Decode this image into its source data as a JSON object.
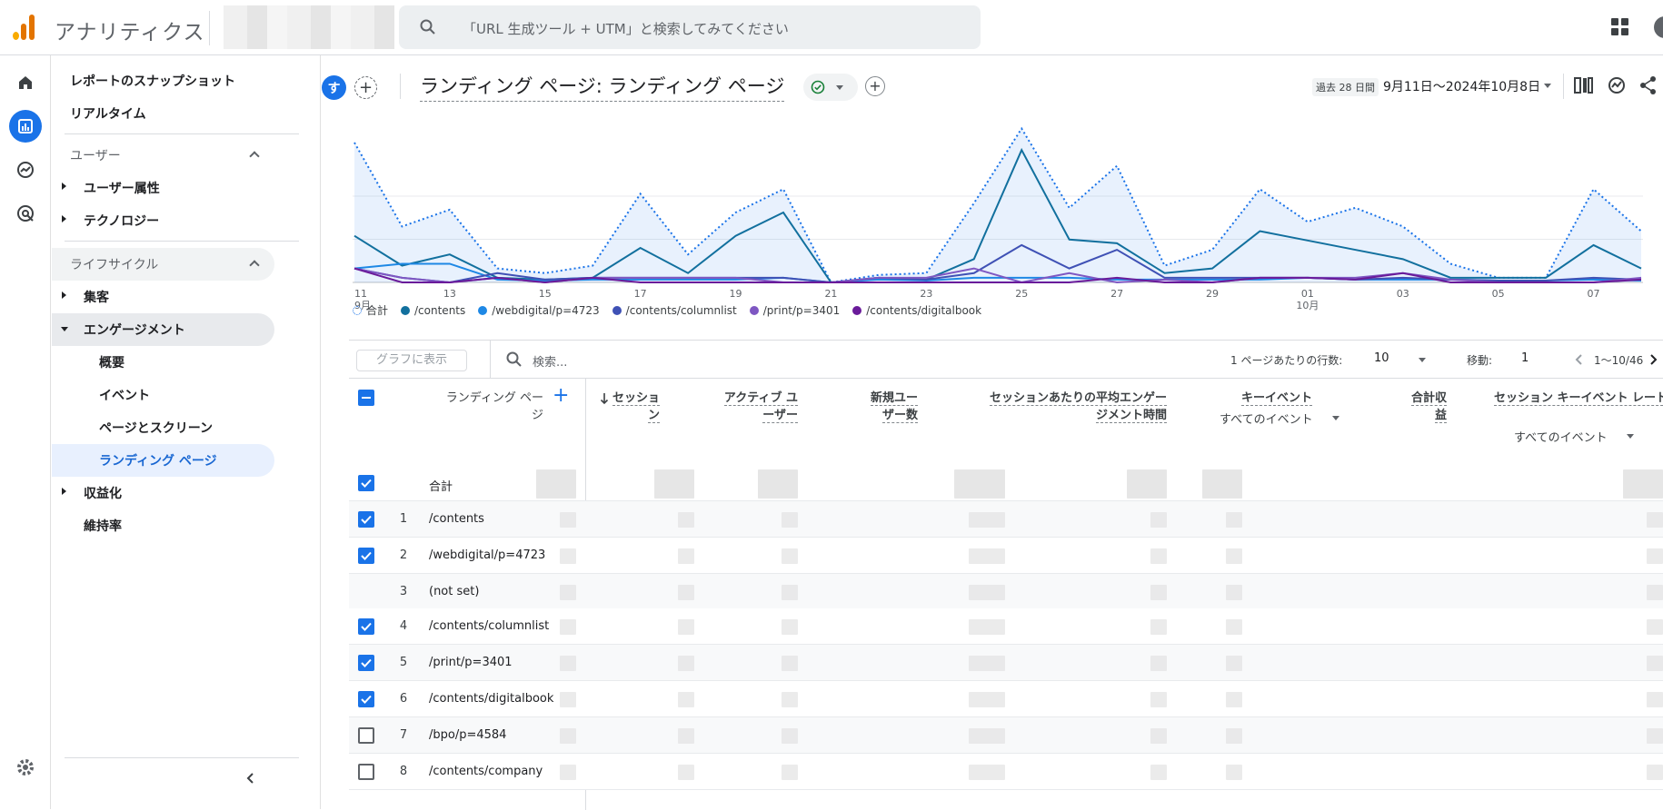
{
  "app": {
    "title": "アナリティクス",
    "search_placeholder": "「URL 生成ツール + UTM」と検索してみてください"
  },
  "nav": {
    "snapshot": "レポートのスナップショット",
    "realtime": "リアルタイム",
    "user_section": "ユーザー",
    "user_attributes": "ユーザー属性",
    "technology": "テクノロジー",
    "lifecycle_section": "ライフサイクル",
    "acquisition": "集客",
    "engagement": "エンゲージメント",
    "overview": "概要",
    "events": "イベント",
    "pages_screens": "ページとスクリーン",
    "landing_page": "ランディング ページ",
    "monetization": "収益化",
    "retention": "維持率"
  },
  "header": {
    "avatar_letter": "す",
    "report_title": "ランディング ページ: ランディング ページ",
    "date_chip": "過去 28 日間",
    "date_range": "9月11日～2024年10月8日"
  },
  "chart_data": {
    "type": "line",
    "x": [
      "11",
      "12",
      "13",
      "14",
      "15",
      "16",
      "17",
      "18",
      "19",
      "20",
      "21",
      "22",
      "23",
      "24",
      "25",
      "26",
      "27",
      "28",
      "29",
      "30",
      "01",
      "02",
      "03",
      "04",
      "05",
      "06",
      "07",
      "08"
    ],
    "x_ticks": [
      "11",
      "13",
      "15",
      "17",
      "19",
      "21",
      "23",
      "25",
      "27",
      "29",
      "01",
      "03",
      "05",
      "07"
    ],
    "x_month_labels": [
      {
        "at": "11",
        "label": "9月"
      },
      {
        "at": "01",
        "label": "10月"
      }
    ],
    "series": [
      {
        "name": "合計",
        "color": "#1a73e8",
        "style": "dotted-area",
        "values": [
          150,
          60,
          78,
          15,
          10,
          18,
          95,
          30,
          75,
          100,
          0,
          8,
          10,
          85,
          165,
          80,
          125,
          18,
          35,
          100,
          65,
          80,
          60,
          20,
          5,
          5,
          100,
          55
        ]
      },
      {
        "name": "/contents",
        "color": "#12709e",
        "values": [
          50,
          18,
          30,
          5,
          3,
          5,
          37,
          10,
          50,
          75,
          0,
          5,
          3,
          25,
          142,
          46,
          42,
          10,
          15,
          55,
          45,
          35,
          25,
          5,
          5,
          5,
          40,
          15
        ]
      },
      {
        "name": "/webdigital/p=4723",
        "color": "#1e88e5",
        "values": [
          15,
          20,
          20,
          3,
          2,
          3,
          3,
          3,
          3,
          5,
          0,
          3,
          2,
          5,
          5,
          5,
          3,
          3,
          3,
          3,
          5,
          3,
          3,
          3,
          2,
          2,
          3,
          2
        ]
      },
      {
        "name": "/contents/columnlist",
        "color": "#3f51b5",
        "values": [
          15,
          5,
          0,
          10,
          3,
          5,
          5,
          5,
          5,
          5,
          0,
          5,
          3,
          10,
          40,
          15,
          35,
          5,
          5,
          5,
          5,
          3,
          5,
          3,
          2,
          2,
          5,
          3
        ]
      },
      {
        "name": "/print/p=3401",
        "color": "#7e57c2",
        "values": [
          15,
          5,
          0,
          5,
          0,
          5,
          5,
          5,
          5,
          0,
          0,
          5,
          5,
          15,
          0,
          10,
          0,
          3,
          0,
          5,
          5,
          5,
          10,
          3,
          0,
          0,
          0,
          5
        ]
      },
      {
        "name": "/contents/digitalbook",
        "color": "#6a1b9a",
        "values": [
          15,
          0,
          0,
          5,
          0,
          5,
          0,
          0,
          0,
          0,
          0,
          0,
          0,
          0,
          0,
          0,
          5,
          0,
          0,
          5,
          5,
          3,
          10,
          0,
          0,
          0,
          0,
          3
        ]
      }
    ],
    "ylim": [
      0,
      150
    ]
  },
  "table": {
    "graph_button": "グラフに表示",
    "search_placeholder": "検索...",
    "rows_per_page_label": "1 ページあたりの行数:",
    "rows_per_page": "10",
    "goto_label": "移動:",
    "goto_value": "1",
    "page_range": "1〜10/46",
    "dimension_header": "ランディング ページ",
    "columns": [
      {
        "label": "セッション",
        "sub": ""
      },
      {
        "label": "アクティブ ユーザー",
        "sub": ""
      },
      {
        "label": "新規ユーザー数",
        "sub": ""
      },
      {
        "label": "セッションあたりの平均エンゲージメント時間",
        "sub": ""
      },
      {
        "label": "キーイベント",
        "sub": "すべてのイベント"
      },
      {
        "label": "合計収益",
        "sub": ""
      },
      {
        "label": "セッション キーイベント レート",
        "sub": "すべてのイベント"
      }
    ],
    "total_label": "合計",
    "rows": [
      {
        "num": "1",
        "page": "/contents",
        "checked": true
      },
      {
        "num": "2",
        "page": "/webdigital/p=4723",
        "checked": true
      },
      {
        "num": "3",
        "page": "(not set)",
        "checked": null
      },
      {
        "num": "4",
        "page": "/contents/columnlist",
        "checked": true
      },
      {
        "num": "5",
        "page": "/print/p=3401",
        "checked": true
      },
      {
        "num": "6",
        "page": "/contents/digitalbook",
        "checked": true
      },
      {
        "num": "7",
        "page": "/bpo/p=4584",
        "checked": false
      },
      {
        "num": "8",
        "page": "/contents/company",
        "checked": false
      }
    ]
  }
}
